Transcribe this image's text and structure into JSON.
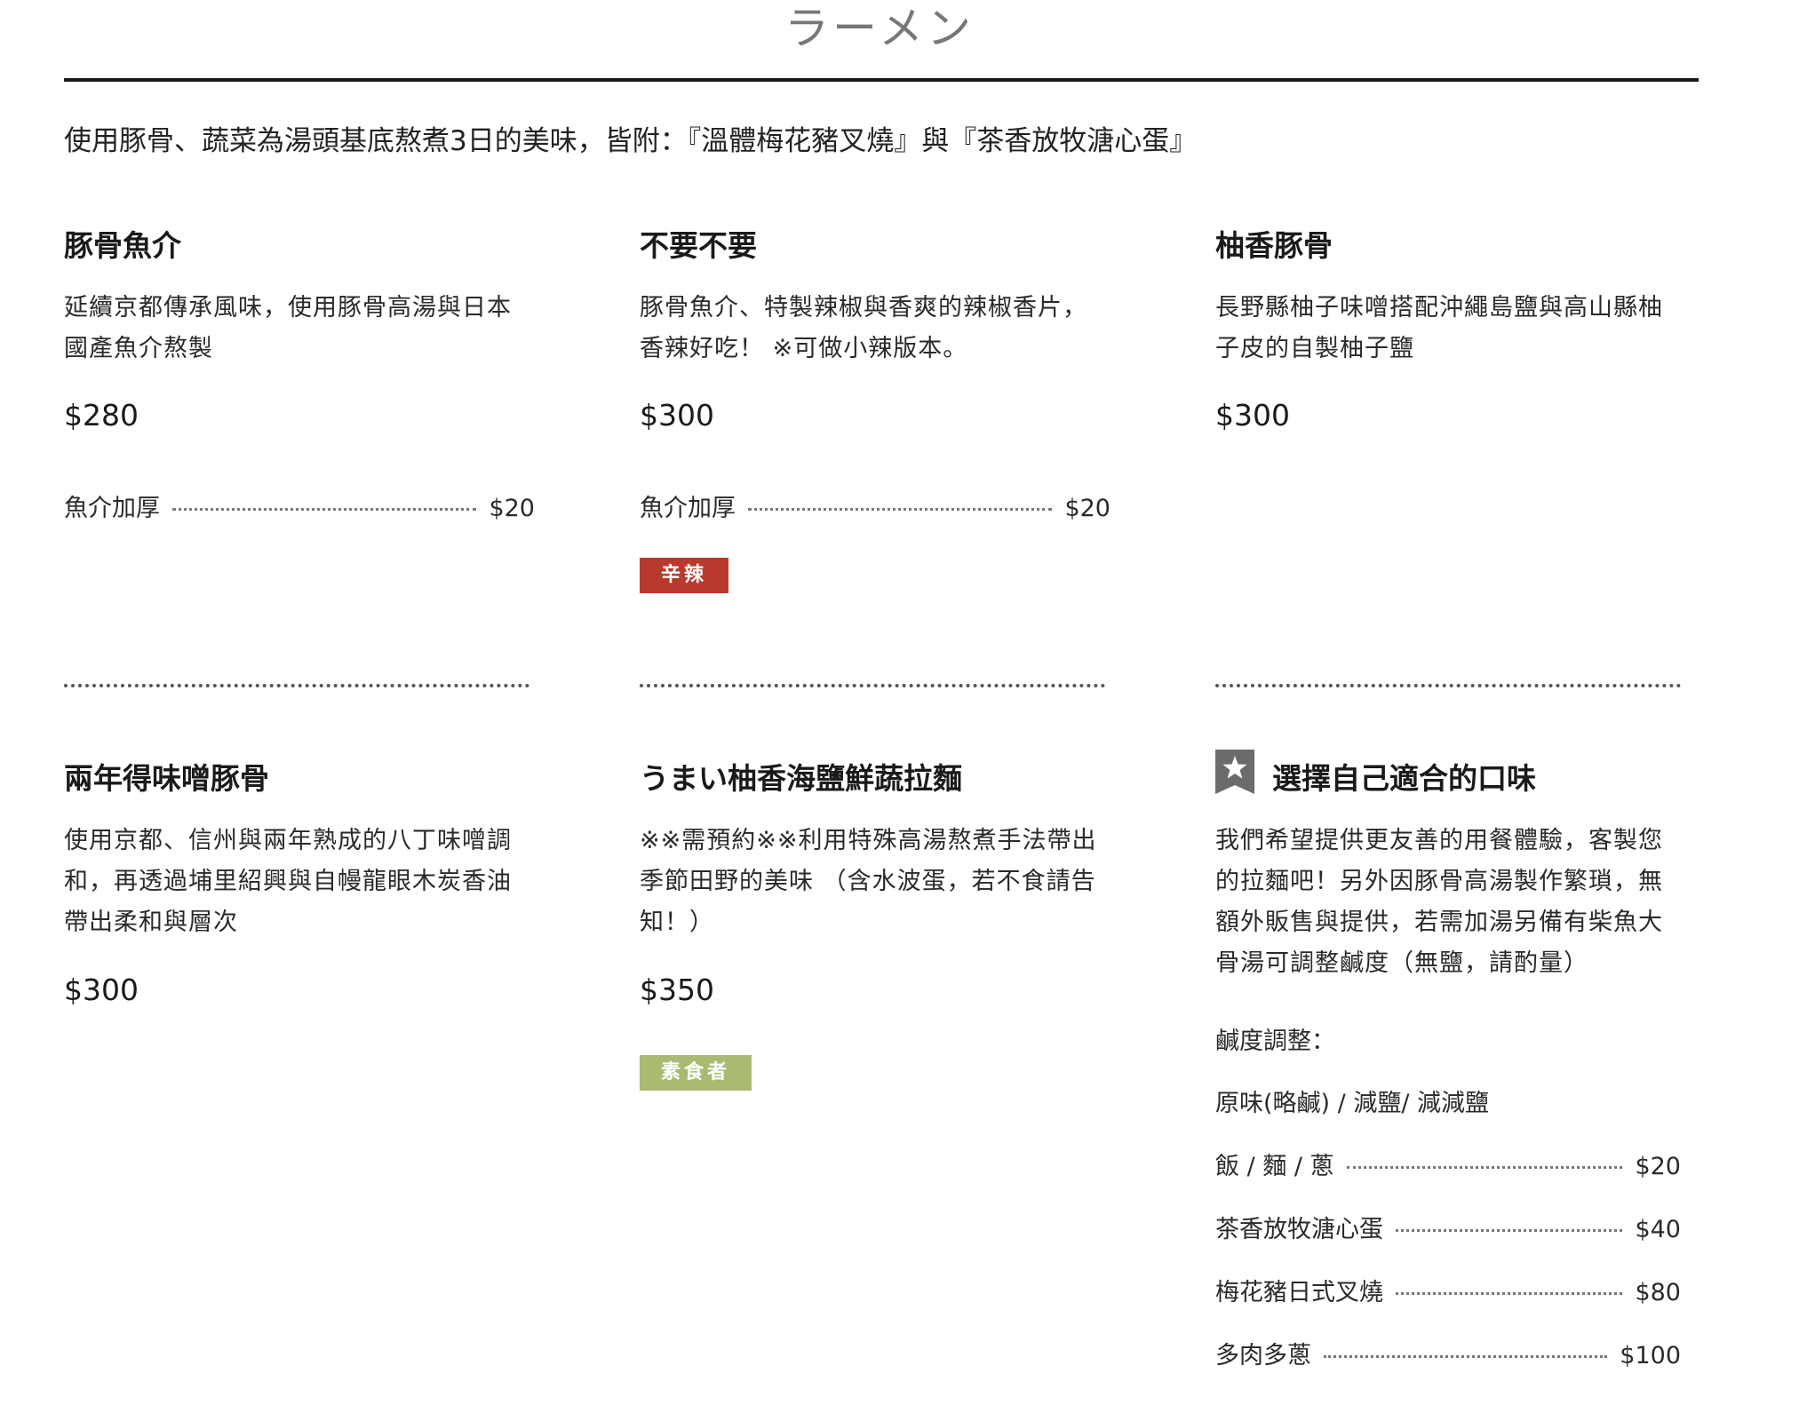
{
  "page": {
    "title": "ラーメン",
    "intro": "使用豚骨、蔬菜為湯頭基底熬煮3日的美味，皆附：『溫體梅花豬叉燒』與『茶香放牧溏心蛋』"
  },
  "menu": {
    "items": [
      {
        "name": "豚骨魚介",
        "desc": "延續京都傳承風味，使用豚骨高湯與日本國產魚介熬製",
        "price": "$280",
        "addon": {
          "label": "魚介加厚",
          "price": "$20"
        }
      },
      {
        "name": "不要不要",
        "desc": "豚骨魚介、特製辣椒與香爽的辣椒香片，香辣好吃！ ※可做小辣版本。",
        "price": "$300",
        "addon": {
          "label": "魚介加厚",
          "price": "$20"
        },
        "tag": "辛辣"
      },
      {
        "name": "柚香豚骨",
        "desc": "長野縣柚子味噌搭配沖繩島鹽與高山縣柚子皮的自製柚子鹽",
        "price": "$300"
      },
      {
        "name": "兩年得味噌豚骨",
        "desc": "使用京都、信州與兩年熟成的八丁味噌調和，再透過埔里紹興與自幔龍眼木炭香油帶出柔和與層次",
        "price": "$300"
      },
      {
        "name": "うまい柚香海鹽鮮蔬拉麵",
        "desc": "※※需預約※※利用特殊高湯熬煮手法帶出季節田野的美味 （含水波蛋，若不食請告知！）",
        "price": "$350",
        "tag": "素食者"
      }
    ],
    "special": {
      "icon": "star-badge-icon",
      "title": "選擇自己適合的口味",
      "desc": "我們希望提供更友善的用餐體驗，客製您的拉麵吧！另外因豚骨高湯製作繁瑣，無額外販售與提供，若需加湯另備有柴魚大骨湯可調整鹹度（無鹽，請酌量）",
      "salt_label": "鹹度調整：",
      "salt_options": "原味(略鹹) / 減鹽/ 減減鹽",
      "extras": [
        {
          "label": "飯 / 麵 / 蔥",
          "price": "$20"
        },
        {
          "label": "茶香放牧溏心蛋",
          "price": "$40"
        },
        {
          "label": "梅花豬日式叉燒",
          "price": "$80"
        },
        {
          "label": "多肉多蔥",
          "price": "$100"
        }
      ]
    }
  },
  "colors": {
    "spicy_tag": "#b83a2e",
    "veg_tag": "#a9bb72",
    "star_badge": "#6b6b6b"
  }
}
